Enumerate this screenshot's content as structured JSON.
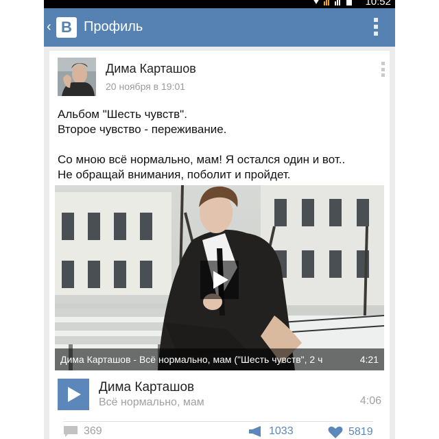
{
  "status_bar": {
    "time": "10:52"
  },
  "app_bar": {
    "logo": "B",
    "title": "Профиль",
    "back_icon": "chevron-left-icon",
    "menu_icon": "overflow-icon"
  },
  "post": {
    "author": "Дима Карташов",
    "date": "20 ноября в 19:01",
    "text_lines": [
      "Альбом \"Шесть чувств\".",
      "Второе чувство - переживание.",
      "",
      "Со мною всё нормально, мам! Я остался один и вот..",
      "Не обращай внимания, поболит и пройдет."
    ],
    "video": {
      "title": "Дима Карташов - Всё нормально, мам (\"Шесть чувств\", 2 ч",
      "duration": "4:21"
    },
    "audio": {
      "artist": "Дима Карташов",
      "track": "Всё нормально, мам",
      "duration": "4:06"
    },
    "actions": {
      "comments": "369",
      "shares": "1033",
      "likes": "5819"
    }
  },
  "colors": {
    "brand": "#5582b3",
    "accent": "#5b87ba",
    "muted": "#a0a0a0"
  }
}
